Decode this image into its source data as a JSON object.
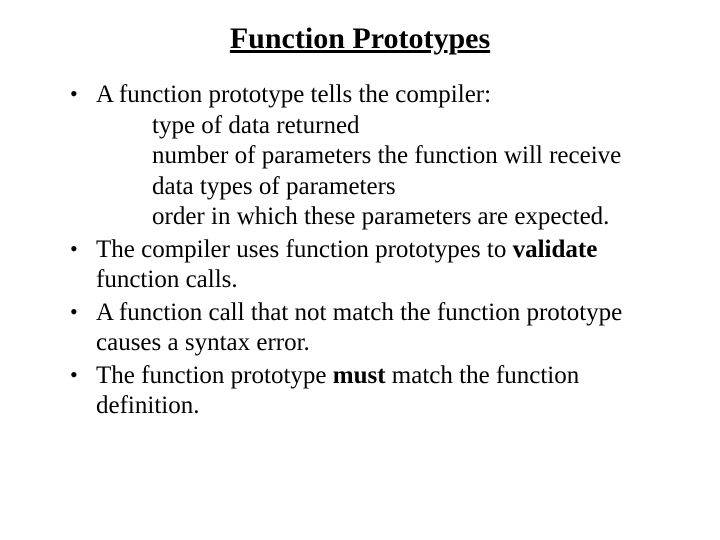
{
  "title": "Function Prototypes",
  "bullets": {
    "b1": {
      "lead": "A function prototype tells the compiler:",
      "sub1": "type of data returned",
      "sub2": "number of parameters the function will receive",
      "sub3": "data types of parameters",
      "sub4": "order in which these parameters are expected."
    },
    "b2": {
      "pre": "The compiler uses function prototypes to ",
      "bold": "validate",
      "post": " function calls."
    },
    "b3": "A function call that not match the function prototype causes a syntax error.",
    "b4": {
      "pre": "The function prototype ",
      "bold": "must",
      "post": " match the function definition."
    }
  }
}
